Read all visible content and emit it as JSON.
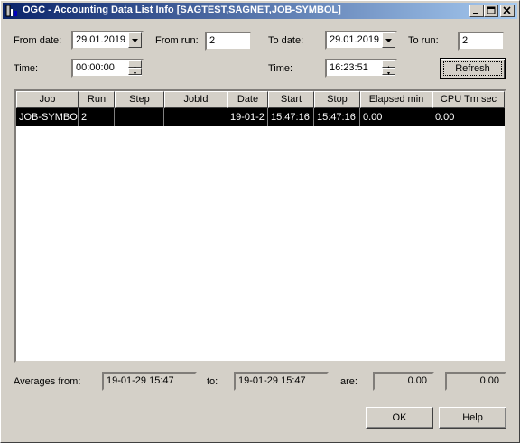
{
  "window": {
    "title": "OGC - Accounting Data List Info [SAGTEST,SAGNET,JOB-SYMBOL]",
    "buttons": [
      "minimize-icon",
      "maximize-icon",
      "close-icon"
    ]
  },
  "filters": {
    "from_date_label": "From date:",
    "from_date": "29.01.2019",
    "from_run_label": "From run:",
    "from_run": "2",
    "to_date_label": "To date:",
    "to_date": "29.01.2019",
    "to_run_label": "To run:",
    "to_run": "2",
    "time_label": "Time:",
    "from_time": "00:00:00",
    "time2_label": "Time:",
    "to_time": "16:23:51",
    "refresh_label": "Refresh"
  },
  "table": {
    "columns": [
      "Job",
      "Run",
      "Step",
      "JobId",
      "Date",
      "Start",
      "Stop",
      "Elapsed min",
      "CPU Tm sec"
    ],
    "rows": [
      [
        "JOB-SYMBO",
        "2",
        "",
        "",
        "19-01-2",
        "15:47:16",
        "15:47:16",
        "0.00",
        "0.00"
      ]
    ]
  },
  "averages": {
    "from_label": "Averages from:",
    "from_value": "19-01-29 15:47",
    "to_label": "to:",
    "to_value": "19-01-29 15:47",
    "are_label": "are:",
    "elapsed_avg": "0.00",
    "cpu_avg": "0.00"
  },
  "footer": {
    "ok_label": "OK",
    "help_label": "Help"
  }
}
